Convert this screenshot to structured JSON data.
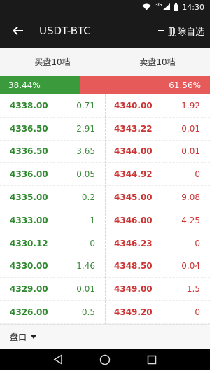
{
  "status_bar": {
    "time": "14:30",
    "network": "3G"
  },
  "header": {
    "title": "USDT-BTC",
    "remove_label": "删除自选"
  },
  "tabs": [
    {
      "label": "买盘10档"
    },
    {
      "label": "卖盘10档"
    }
  ],
  "ratio": {
    "buy_percent": "38.44%",
    "sell_percent": "61.56%",
    "buy_fraction": 0.3844,
    "buy_color": "#3b9a3b",
    "sell_color": "#e75a5a"
  },
  "bids": [
    {
      "price": "4338.00",
      "qty": "0.71"
    },
    {
      "price": "4336.50",
      "qty": "2.91"
    },
    {
      "price": "4336.50",
      "qty": "3.65"
    },
    {
      "price": "4336.00",
      "qty": "0.05"
    },
    {
      "price": "4335.00",
      "qty": "0.2"
    },
    {
      "price": "4333.00",
      "qty": "1"
    },
    {
      "price": "4330.12",
      "qty": "0"
    },
    {
      "price": "4330.00",
      "qty": "1.46"
    },
    {
      "price": "4329.00",
      "qty": "0.01"
    },
    {
      "price": "4326.00",
      "qty": "0.5"
    }
  ],
  "asks": [
    {
      "price": "4340.00",
      "qty": "1.92"
    },
    {
      "price": "4343.22",
      "qty": "0.01"
    },
    {
      "price": "4344.00",
      "qty": "0.01"
    },
    {
      "price": "4344.92",
      "qty": "0"
    },
    {
      "price": "4345.00",
      "qty": "9.08"
    },
    {
      "price": "4346.00",
      "qty": "4.25"
    },
    {
      "price": "4346.23",
      "qty": "0"
    },
    {
      "price": "4348.50",
      "qty": "0.04"
    },
    {
      "price": "4349.00",
      "qty": "1.5"
    },
    {
      "price": "4349.20",
      "qty": "0"
    }
  ],
  "footer": {
    "label": "盘口"
  },
  "icons": {
    "back": "arrow-left-icon",
    "wifi": "wifi-icon",
    "signal": "signal-icon",
    "battery": "battery-icon",
    "nav_back": "triangle-back-icon",
    "nav_home": "circle-home-icon",
    "nav_recent": "square-recent-icon"
  }
}
